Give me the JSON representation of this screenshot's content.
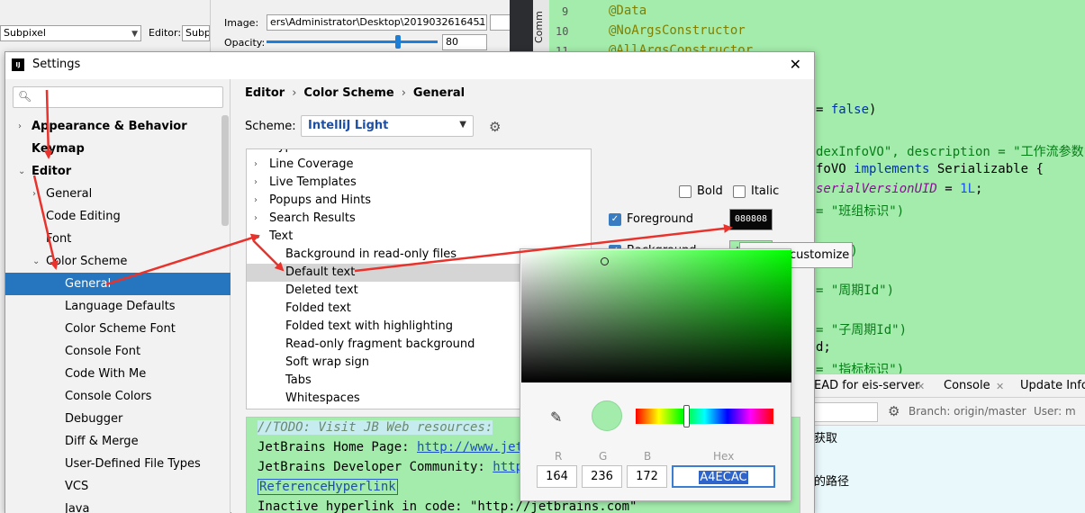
{
  "background": {
    "top_bar": {
      "subpixel_value": "Subpixel",
      "editor_label": "Editor:",
      "editor_value": "Subpix",
      "image_label": "Image:",
      "image_path": "ers\\Administrator\\Desktop\\2019032616451124.png",
      "opacity_label": "Opacity:",
      "opacity_value": "80",
      "opacity_level_percent": 75
    },
    "editor": {
      "side_label": "Comm",
      "line_numbers": [
        "9",
        "10",
        "11"
      ],
      "lines": {
        "l1": "@Data",
        "l2": "@NoArgsConstructor",
        "l3": "@AllArgsConstructor",
        "l4_kw": "false",
        "l4_rest": ")",
        "l5_a": "dexInfoVO\", description = \"工作流参数中的",
        "l6_a": "foVO ",
        "l6_kw": "implements",
        "l6_b": " Serializable {",
        "l7_it": "serialVersionUID",
        "l7_eq": " = ",
        "l7_num": "1L",
        "l7_end": ";",
        "l8": "\"班组标识\")",
        "l9": "名\")",
        "l10": "\"周期Id\")",
        "l11": "\"子周期Id\")",
        "l12": "d;",
        "l13": "\"指标标识\")"
      }
    },
    "bottom_panel": {
      "tab1": "EAD for eis-server",
      "tab2": "Console",
      "tab3": "Update Info:",
      "branch": "Branch: origin/master",
      "user": "User: m",
      "log1": "获取",
      "log2": "的路径"
    }
  },
  "dialog": {
    "title": "Settings",
    "left_tree": [
      {
        "label": "Appearance & Behavior",
        "level": 0,
        "arrow": "›",
        "bold": true
      },
      {
        "label": "Keymap",
        "level": 0,
        "arrow": "",
        "bold": true
      },
      {
        "label": "Editor",
        "level": 0,
        "arrow": "⌄",
        "bold": true
      },
      {
        "label": "General",
        "level": 1,
        "arrow": "›"
      },
      {
        "label": "Code Editing",
        "level": 1,
        "arrow": ""
      },
      {
        "label": "Font",
        "level": 1,
        "arrow": ""
      },
      {
        "label": "Color Scheme",
        "level": 1,
        "arrow": "⌄"
      },
      {
        "label": "General",
        "level": 2,
        "arrow": "",
        "selected": true
      },
      {
        "label": "Language Defaults",
        "level": 2,
        "arrow": ""
      },
      {
        "label": "Color Scheme Font",
        "level": 2,
        "arrow": ""
      },
      {
        "label": "Console Font",
        "level": 2,
        "arrow": ""
      },
      {
        "label": "Code With Me",
        "level": 2,
        "arrow": ""
      },
      {
        "label": "Console Colors",
        "level": 2,
        "arrow": ""
      },
      {
        "label": "Debugger",
        "level": 2,
        "arrow": ""
      },
      {
        "label": "Diff & Merge",
        "level": 2,
        "arrow": ""
      },
      {
        "label": "User-Defined File Types",
        "level": 2,
        "arrow": ""
      },
      {
        "label": "VCS",
        "level": 2,
        "arrow": ""
      },
      {
        "label": "Java",
        "level": 2,
        "arrow": ""
      }
    ],
    "breadcrumb": [
      "Editor",
      "Color Scheme",
      "General"
    ],
    "scheme_label": "Scheme:",
    "scheme_value": "IntelliJ Light",
    "element_list": [
      {
        "label": "Hyperlinks",
        "level": 0,
        "arrow": "›"
      },
      {
        "label": "Line Coverage",
        "level": 0,
        "arrow": "›"
      },
      {
        "label": "Live Templates",
        "level": 0,
        "arrow": "›"
      },
      {
        "label": "Popups and Hints",
        "level": 0,
        "arrow": "›"
      },
      {
        "label": "Search Results",
        "level": 0,
        "arrow": "›"
      },
      {
        "label": "Text",
        "level": 0,
        "arrow": "⌄"
      },
      {
        "label": "Background in read-only files",
        "level": 1,
        "arrow": ""
      },
      {
        "label": "Default text",
        "level": 1,
        "arrow": "",
        "highlight": true
      },
      {
        "label": "Deleted text",
        "level": 1,
        "arrow": ""
      },
      {
        "label": "Folded text",
        "level": 1,
        "arrow": ""
      },
      {
        "label": "Folded text with highlighting",
        "level": 1,
        "arrow": ""
      },
      {
        "label": "Read-only fragment background",
        "level": 1,
        "arrow": ""
      },
      {
        "label": "Soft wrap sign",
        "level": 1,
        "arrow": ""
      },
      {
        "label": "Tabs",
        "level": 1,
        "arrow": ""
      },
      {
        "label": "Whitespaces",
        "level": 1,
        "arrow": ""
      }
    ],
    "attributes": {
      "bold_label": "Bold",
      "italic_label": "Italic",
      "foreground_label": "Foreground",
      "foreground_value": "080808",
      "foreground_color": "#080808",
      "background_label": "Background",
      "background_value": "A4ECAC",
      "background_color": "#A4ECAC"
    },
    "preview": {
      "line1": "//TODO: Visit JB Web resources:",
      "line2_label": "JetBrains Home Page: ",
      "line2_link": "http://www.jetbr",
      "line3_label": "JetBrains Developer Community: ",
      "line3_link": "https:",
      "line4": "ReferenceHyperlink",
      "line5": "Inactive hyperlink in code: \"http://jetbrains.com\""
    }
  },
  "tooltip": "Click to customize",
  "color_picker": {
    "r_label": "R",
    "g_label": "G",
    "b_label": "B",
    "hex_label": "Hex",
    "r_value": "164",
    "g_value": "236",
    "b_value": "172",
    "hex_value": "A4ECAC",
    "color": "#A4ECAC",
    "hue_degrees": 126
  },
  "colors": {
    "accent": "#2675BF",
    "annotation_arrow": "#E8322B",
    "editor_bg": "#A4ECAC"
  }
}
